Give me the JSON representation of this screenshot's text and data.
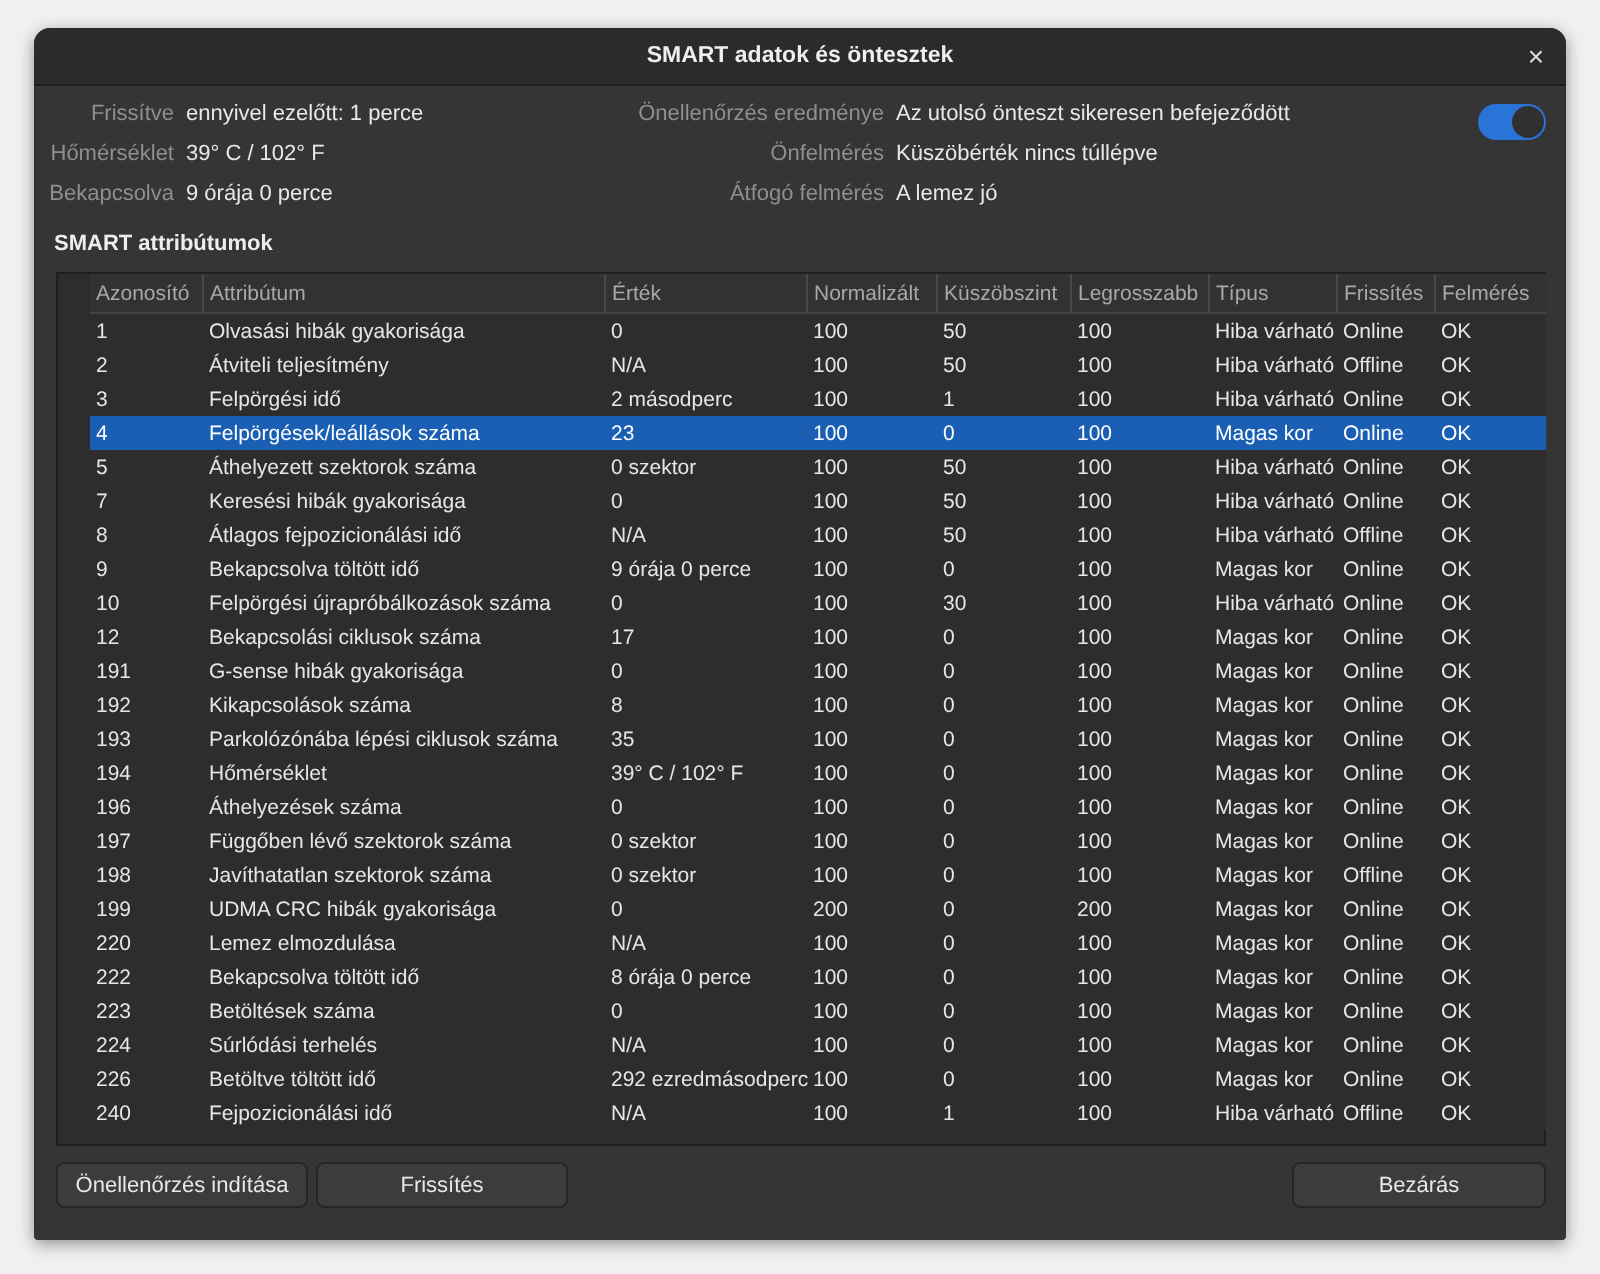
{
  "window": {
    "title": "SMART adatok és öntesztek",
    "close": "×"
  },
  "info_left": [
    {
      "label": "Frissítve",
      "value": "ennyivel ezelőtt: 1 perce"
    },
    {
      "label": "Hőmérséklet",
      "value": "39° C / 102° F"
    },
    {
      "label": "Bekapcsolva",
      "value": "9 órája 0 perce"
    }
  ],
  "info_right": [
    {
      "label": "Önellenőrzés eredménye",
      "value": "Az utolsó önteszt sikeresen befejeződött"
    },
    {
      "label": "Önfelmérés",
      "value": "Küszöbérték nincs túllépve"
    },
    {
      "label": "Átfogó felmérés",
      "value": "A lemez jó"
    }
  ],
  "toggle": {
    "on": true
  },
  "section_title": "SMART attribútumok",
  "table": {
    "columns": [
      "Azonosító",
      "Attribútum",
      "Érték",
      "Normalizált",
      "Küszöbszint",
      "Legrosszabb",
      "Típus",
      "Frissítés",
      "Felmérés"
    ],
    "rows": [
      {
        "selected": false,
        "cells": [
          "1",
          "Olvasási hibák gyakorisága",
          "0",
          "100",
          "50",
          "100",
          "Hiba várható",
          "Online",
          "OK"
        ]
      },
      {
        "selected": false,
        "cells": [
          "2",
          "Átviteli teljesítmény",
          "N/A",
          "100",
          "50",
          "100",
          "Hiba várható",
          "Offline",
          "OK"
        ]
      },
      {
        "selected": false,
        "cells": [
          "3",
          "Felpörgési idő",
          "2 másodperc",
          "100",
          "1",
          "100",
          "Hiba várható",
          "Online",
          "OK"
        ]
      },
      {
        "selected": true,
        "cells": [
          "4",
          "Felpörgések/leállások száma",
          "23",
          "100",
          "0",
          "100",
          "Magas kor",
          "Online",
          "OK"
        ]
      },
      {
        "selected": false,
        "cells": [
          "5",
          "Áthelyezett szektorok száma",
          "0 szektor",
          "100",
          "50",
          "100",
          "Hiba várható",
          "Online",
          "OK"
        ]
      },
      {
        "selected": false,
        "cells": [
          "7",
          "Keresési hibák gyakorisága",
          "0",
          "100",
          "50",
          "100",
          "Hiba várható",
          "Online",
          "OK"
        ]
      },
      {
        "selected": false,
        "cells": [
          "8",
          "Átlagos fejpozicionálási idő",
          "N/A",
          "100",
          "50",
          "100",
          "Hiba várható",
          "Offline",
          "OK"
        ]
      },
      {
        "selected": false,
        "cells": [
          "9",
          "Bekapcsolva töltött idő",
          "9 órája 0 perce",
          "100",
          "0",
          "100",
          "Magas kor",
          "Online",
          "OK"
        ]
      },
      {
        "selected": false,
        "cells": [
          "10",
          "Felpörgési újrapróbálkozások száma",
          "0",
          "100",
          "30",
          "100",
          "Hiba várható",
          "Online",
          "OK"
        ]
      },
      {
        "selected": false,
        "cells": [
          "12",
          "Bekapcsolási ciklusok száma",
          "17",
          "100",
          "0",
          "100",
          "Magas kor",
          "Online",
          "OK"
        ]
      },
      {
        "selected": false,
        "cells": [
          "191",
          "G-sense hibák gyakorisága",
          "0",
          "100",
          "0",
          "100",
          "Magas kor",
          "Online",
          "OK"
        ]
      },
      {
        "selected": false,
        "cells": [
          "192",
          "Kikapcsolások száma",
          "8",
          "100",
          "0",
          "100",
          "Magas kor",
          "Online",
          "OK"
        ]
      },
      {
        "selected": false,
        "cells": [
          "193",
          "Parkolózónába lépési ciklusok száma",
          "35",
          "100",
          "0",
          "100",
          "Magas kor",
          "Online",
          "OK"
        ]
      },
      {
        "selected": false,
        "cells": [
          "194",
          "Hőmérséklet",
          "39° C / 102° F",
          "100",
          "0",
          "100",
          "Magas kor",
          "Online",
          "OK"
        ]
      },
      {
        "selected": false,
        "cells": [
          "196",
          "Áthelyezések száma",
          "0",
          "100",
          "0",
          "100",
          "Magas kor",
          "Online",
          "OK"
        ]
      },
      {
        "selected": false,
        "cells": [
          "197",
          "Függőben lévő szektorok száma",
          "0 szektor",
          "100",
          "0",
          "100",
          "Magas kor",
          "Online",
          "OK"
        ]
      },
      {
        "selected": false,
        "cells": [
          "198",
          "Javíthatatlan szektorok száma",
          "0 szektor",
          "100",
          "0",
          "100",
          "Magas kor",
          "Offline",
          "OK"
        ]
      },
      {
        "selected": false,
        "cells": [
          "199",
          "UDMA CRC hibák gyakorisága",
          "0",
          "200",
          "0",
          "200",
          "Magas kor",
          "Online",
          "OK"
        ]
      },
      {
        "selected": false,
        "cells": [
          "220",
          "Lemez elmozdulása",
          "N/A",
          "100",
          "0",
          "100",
          "Magas kor",
          "Online",
          "OK"
        ]
      },
      {
        "selected": false,
        "cells": [
          "222",
          "Bekapcsolva töltött idő",
          "8 órája 0 perce",
          "100",
          "0",
          "100",
          "Magas kor",
          "Online",
          "OK"
        ]
      },
      {
        "selected": false,
        "cells": [
          "223",
          "Betöltések száma",
          "0",
          "100",
          "0",
          "100",
          "Magas kor",
          "Online",
          "OK"
        ]
      },
      {
        "selected": false,
        "cells": [
          "224",
          "Súrlódási terhelés",
          "N/A",
          "100",
          "0",
          "100",
          "Magas kor",
          "Online",
          "OK"
        ]
      },
      {
        "selected": false,
        "cells": [
          "226",
          "Betöltve töltött idő",
          "292 ezredmásodperc",
          "100",
          "0",
          "100",
          "Magas kor",
          "Online",
          "OK"
        ]
      },
      {
        "selected": false,
        "cells": [
          "240",
          "Fejpozicionálási idő",
          "N/A",
          "100",
          "1",
          "100",
          "Hiba várható",
          "Offline",
          "OK"
        ]
      }
    ]
  },
  "buttons_left": [
    "Önellenőrzés indítása",
    "Frissítés"
  ],
  "buttons_right": [
    "Bezárás"
  ]
}
